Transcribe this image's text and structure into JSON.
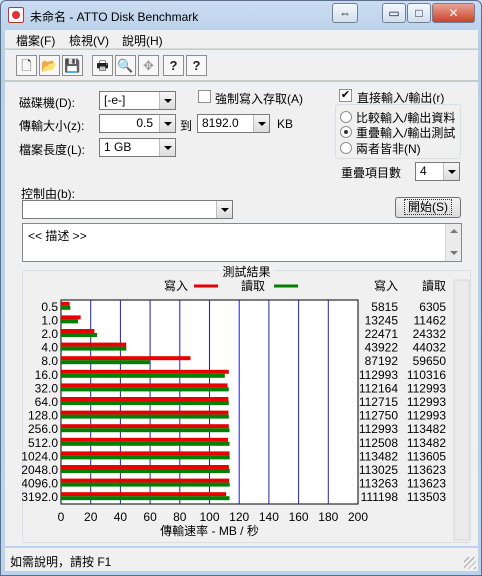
{
  "window": {
    "title": "未命名 - ATTO Disk Benchmark",
    "caption_buttons": {
      "restore": "⇔",
      "minimize": "▭",
      "maximize": "□",
      "close": "✕"
    }
  },
  "menu": [
    "檔案(F)",
    "檢視(V)",
    "說明(H)"
  ],
  "toolbar": {
    "icons": [
      "new-file-icon",
      "open-folder-icon",
      "save-disk-icon",
      "print-icon",
      "print-preview-icon",
      "move-cross-icon",
      "help-icon",
      "context-help-icon"
    ],
    "glyphs": [
      "🗋",
      "📂",
      "💾",
      "🖶",
      "🔍",
      "✥",
      "?",
      "?"
    ]
  },
  "settings": {
    "drive_label": "磁碟機(D):",
    "drive_value": "[-e-]",
    "transfer_label": "傳輸大小(z):",
    "transfer_from": "0.5",
    "transfer_to_label": "到",
    "transfer_to": "8192.0",
    "transfer_unit": "KB",
    "file_length_label": "檔案長度(L):",
    "file_length_value": "1 GB",
    "force_write_label": "強制寫入存取(A)",
    "force_write_checked": false,
    "direct_io_label": "直接輸入/輸出(r)",
    "direct_io_checked": true,
    "radio_compare": "比較輸入/輸出資料",
    "radio_overlap": "重疊輸入/輸出測試",
    "radio_neither": "兩者皆非(N)",
    "selected_mode": "重疊輸入/輸出測試",
    "queue_label": "重疊項目數",
    "queue_value": "4",
    "controlled_by_label": "控制由(b):",
    "controlled_by_value": "",
    "start_button": "開始(S)",
    "description": "<<  描述  >>"
  },
  "chart_data": {
    "type": "bar",
    "title": "測試結果",
    "xlabel": "傳輸速率 - MB / 秒",
    "xlim": [
      0,
      200
    ],
    "x_ticks": [
      0,
      20,
      40,
      60,
      80,
      100,
      120,
      140,
      160,
      180,
      200
    ],
    "grid": true,
    "legend": [
      {
        "name": "寫入",
        "color": "#e60000"
      },
      {
        "name": "讀取",
        "color": "#008000"
      }
    ],
    "categories": [
      "0.5",
      "1.0",
      "2.0",
      "4.0",
      "8.0",
      "16.0",
      "32.0",
      "64.0",
      "128.0",
      "256.0",
      "512.0",
      "1024.0",
      "2048.0",
      "4096.0",
      "3192.0"
    ],
    "series": [
      {
        "name": "寫入",
        "values": [
          5815,
          13245,
          22471,
          43922,
          87192,
          112993,
          112164,
          112715,
          112750,
          112993,
          112508,
          113482,
          113025,
          113263,
          111198
        ]
      },
      {
        "name": "讀取",
        "values": [
          6305,
          11462,
          24332,
          44032,
          59650,
          110316,
          112993,
          112993,
          112993,
          113482,
          113482,
          113605,
          113623,
          113623,
          113503
        ]
      }
    ],
    "value_columns": [
      "寫入",
      "讀取"
    ]
  },
  "status": {
    "text": "如需說明，請按 F1"
  }
}
